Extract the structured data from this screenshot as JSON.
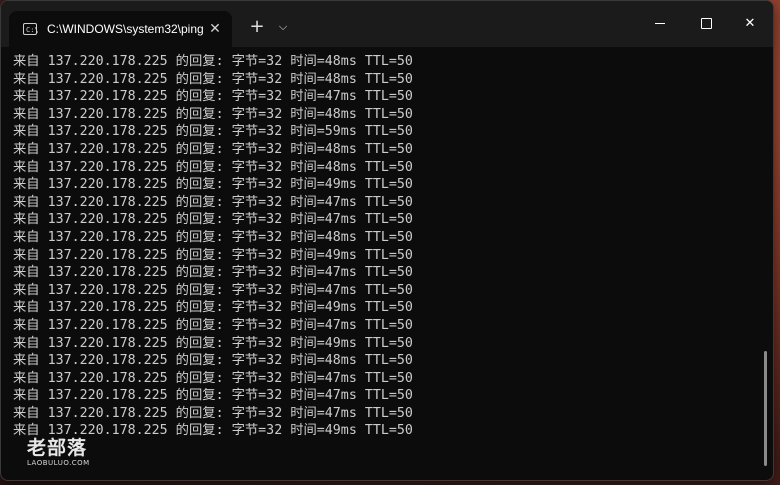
{
  "window": {
    "tab_title": "C:\\WINDOWS\\system32\\ping",
    "tab_icon_text": "C:\\",
    "new_tab_symbol": "+",
    "dropdown_symbol": "⌵",
    "close_tab_symbol": "✕",
    "close_symbol": "✕"
  },
  "terminal": {
    "lines": [
      "来自 137.220.178.225 的回复: 字节=32 时间=48ms TTL=50",
      "来自 137.220.178.225 的回复: 字节=32 时间=48ms TTL=50",
      "来自 137.220.178.225 的回复: 字节=32 时间=47ms TTL=50",
      "来自 137.220.178.225 的回复: 字节=32 时间=48ms TTL=50",
      "来自 137.220.178.225 的回复: 字节=32 时间=59ms TTL=50",
      "来自 137.220.178.225 的回复: 字节=32 时间=48ms TTL=50",
      "来自 137.220.178.225 的回复: 字节=32 时间=48ms TTL=50",
      "来自 137.220.178.225 的回复: 字节=32 时间=49ms TTL=50",
      "来自 137.220.178.225 的回复: 字节=32 时间=47ms TTL=50",
      "来自 137.220.178.225 的回复: 字节=32 时间=47ms TTL=50",
      "来自 137.220.178.225 的回复: 字节=32 时间=48ms TTL=50",
      "来自 137.220.178.225 的回复: 字节=32 时间=49ms TTL=50",
      "来自 137.220.178.225 的回复: 字节=32 时间=47ms TTL=50",
      "来自 137.220.178.225 的回复: 字节=32 时间=47ms TTL=50",
      "来自 137.220.178.225 的回复: 字节=32 时间=49ms TTL=50",
      "来自 137.220.178.225 的回复: 字节=32 时间=47ms TTL=50",
      "来自 137.220.178.225 的回复: 字节=32 时间=49ms TTL=50",
      "来自 137.220.178.225 的回复: 字节=32 时间=48ms TTL=50",
      "来自 137.220.178.225 的回复: 字节=32 时间=47ms TTL=50",
      "来自 137.220.178.225 的回复: 字节=32 时间=47ms TTL=50",
      "来自 137.220.178.225 的回复: 字节=32 时间=47ms TTL=50",
      "来自 137.220.178.225 的回复: 字节=32 时间=49ms TTL=50"
    ]
  },
  "watermark": {
    "main": "老部落",
    "sub": "LAOBULUO.COM"
  },
  "colors": {
    "terminal_bg": "#0c0c0c",
    "terminal_text": "#cccccc",
    "titlebar_bg": "#1b1b1b"
  }
}
